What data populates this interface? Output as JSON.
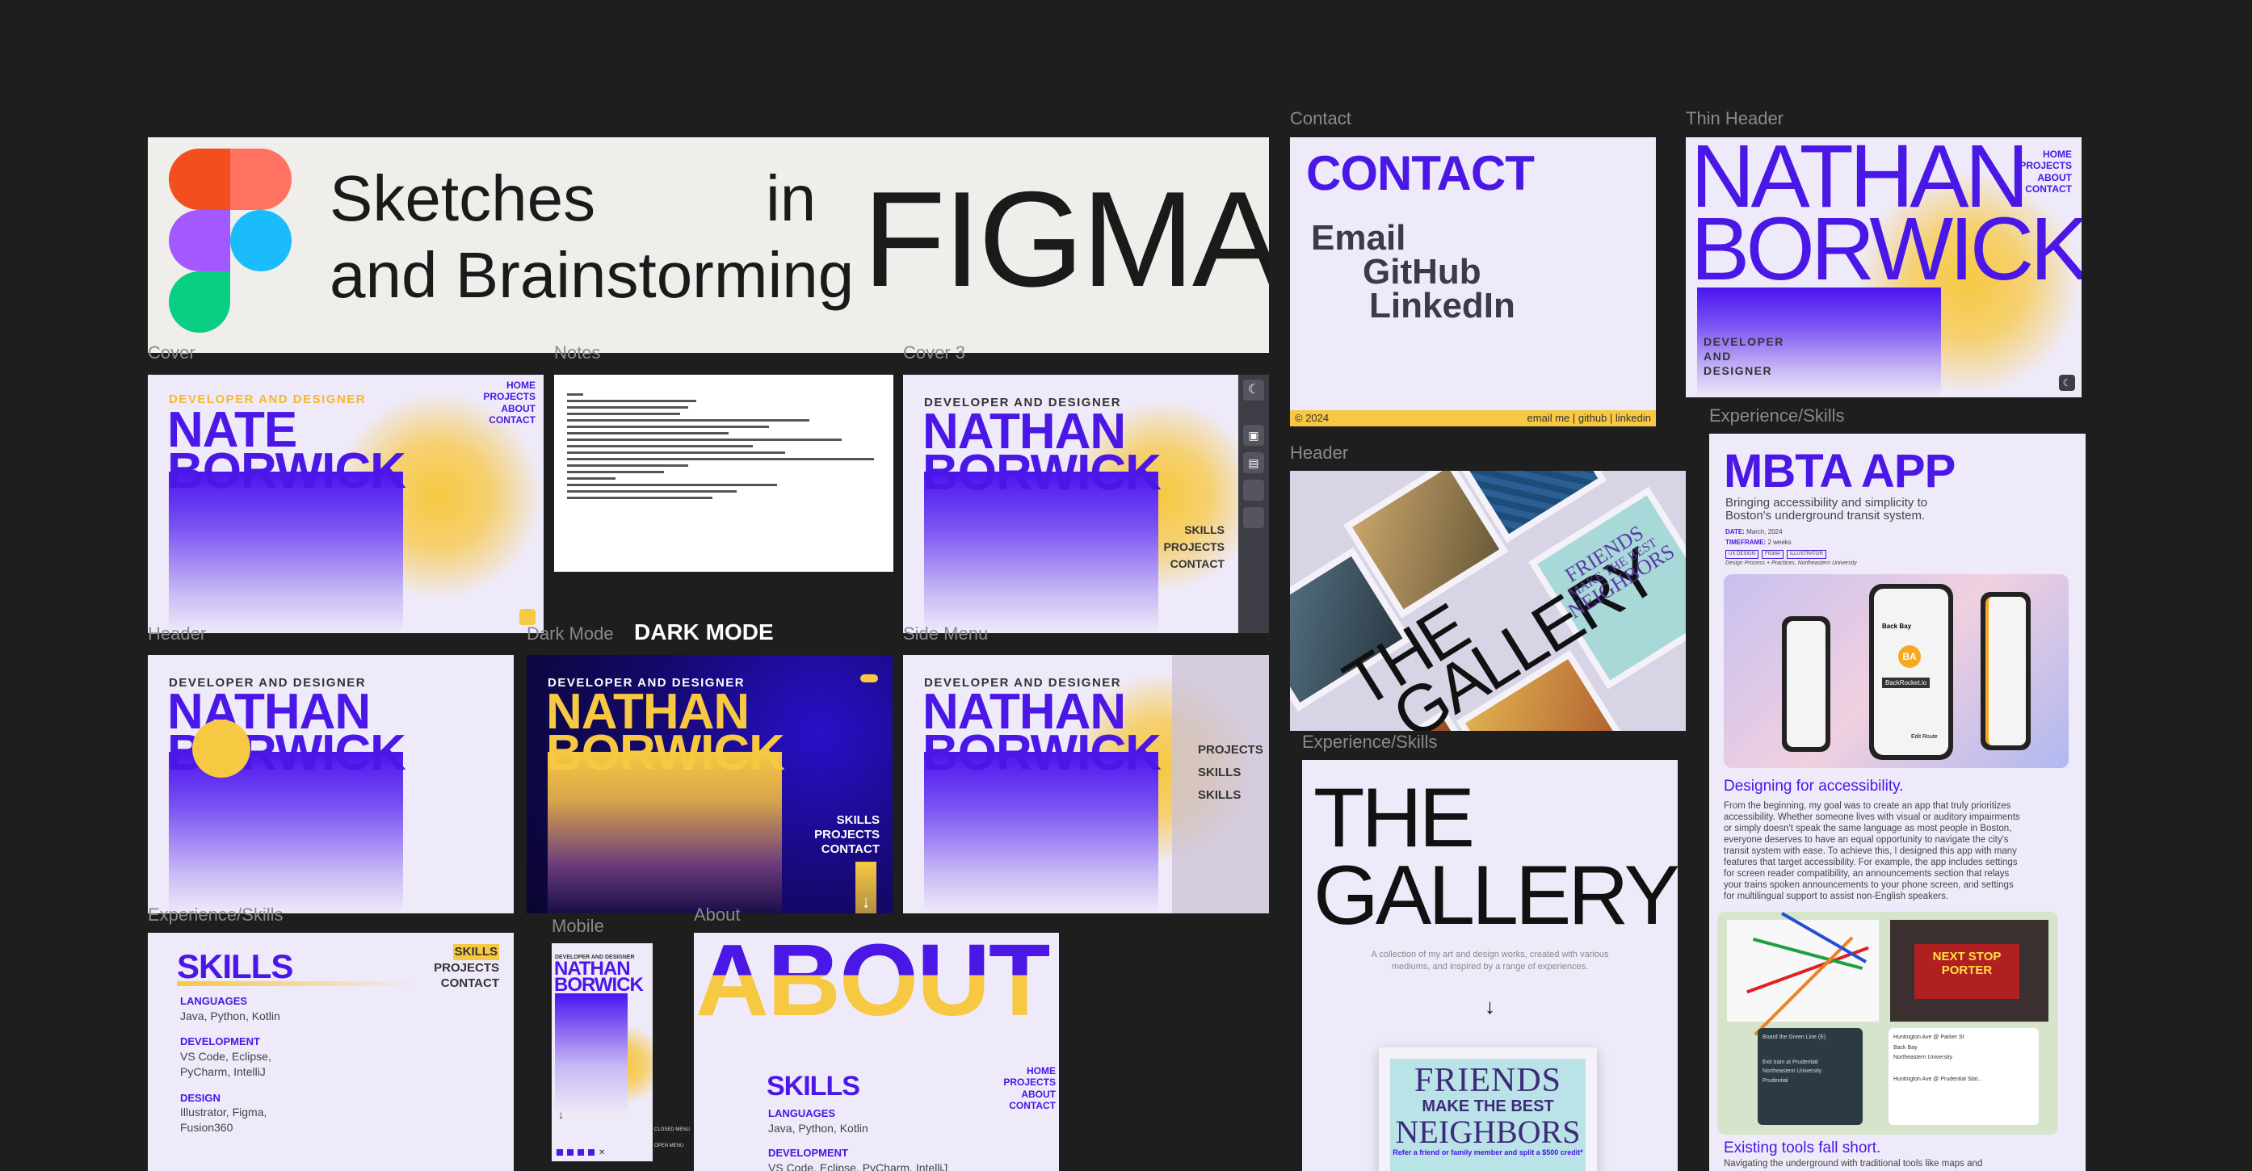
{
  "title_banner": {
    "line1": "Sketches",
    "word_in": "in",
    "line2": "and Brainstorming",
    "figma": "FIGMA"
  },
  "labels": {
    "cover": "Cover",
    "notes": "Notes",
    "cover3": "Cover 3",
    "header": "Header",
    "dark_mode": "Dark Mode",
    "side_menu": "Side Menu",
    "experience_skills": "Experience/Skills",
    "mobile": "Mobile",
    "about": "About",
    "contact": "Contact",
    "thin_header": "Thin Header",
    "header2": "Header",
    "experience_skills2": "Experience/Skills",
    "experience_skills3": "Experience/Skills"
  },
  "dark_mode_heading": "DARK MODE",
  "common": {
    "dev_designer": "DEVELOPER AND DESIGNER",
    "nathan": "NATHAN",
    "borwick": "BORWICK",
    "nate": "NATE",
    "nav": [
      "HOME",
      "PROJECTS",
      "ABOUT",
      "CONTACT"
    ],
    "nav3": [
      "SKILLS",
      "PROJECTS",
      "CONTACT"
    ],
    "side": [
      "PROJECTS",
      "SKILLS",
      "SKILLS"
    ],
    "arrow": "↓"
  },
  "skills": {
    "title": "SKILLS",
    "nav": [
      "SKILLS",
      "PROJECTS",
      "CONTACT"
    ],
    "groups": [
      {
        "h": "LANGUAGES",
        "t": [
          "Java, Python, Kotlin"
        ]
      },
      {
        "h": "DEVELOPMENT",
        "t": [
          "VS Code, Eclipse,",
          "PyCharm, IntelliJ"
        ]
      },
      {
        "h": "DESIGN",
        "t": [
          "Illustrator, Figma,",
          "Fusion360"
        ]
      }
    ]
  },
  "mobile": {
    "head": "DEVELOPER AND DESIGNER",
    "close": "CLOSED MENU",
    "open": "OPEN MENU"
  },
  "about": {
    "title": "ABOUT",
    "skills": "SKILLS",
    "g1h": "LANGUAGES",
    "g1t": "Java, Python, Kotlin",
    "g2h": "DEVELOPMENT",
    "g2t": "VS Code, Eclipse, PyCharm, IntelliJ"
  },
  "contact": {
    "title": "CONTACT",
    "email": "Email",
    "github": "GitHub",
    "linkedin": "LinkedIn",
    "footer_left": "© 2024",
    "footer_right": "email me | github | linkedin"
  },
  "thin": {
    "line1": "NATHAN",
    "line2": "BORWICK",
    "sub": [
      "DEVELOPER",
      "AND",
      "DESIGNER"
    ]
  },
  "gallery_header": {
    "title1": "THE",
    "title2": "GALLERY",
    "book1": "FRIENDS",
    "book2": "MAKE THE BEST",
    "book3": "NEIGHBORS"
  },
  "gallery_page": {
    "title1": "THE",
    "title2": "GALLERY",
    "desc1": "A collection of my art and design works, created with various",
    "desc2": "mediums, and inspired by a range of experiences.",
    "poster1": "FRIENDS",
    "poster2": "MAKE THE BEST",
    "poster3": "NEIGHBORS",
    "poster4": "Refer a friend or family member and split a $500 credit*"
  },
  "mbta": {
    "title": "MBTA APP",
    "sub1": "Bringing accessibility and simplicity to",
    "sub2": "Boston's underground transit system.",
    "date_label": "DATE:",
    "date": "March, 2024",
    "tf_label": "TIMEFRAME:",
    "tf": "2 weeks",
    "tags": [
      "UX DESIGN",
      "FIGMA",
      "ILLUSTRATOR"
    ],
    "course": "Design Process + Practices, Northeastern University",
    "h1": "Designing for accessibility.",
    "p1": [
      "From the beginning, my goal was to create an app that truly prioritizes",
      "accessibility. Whether someone lives with visual or auditory impairments",
      "or simply doesn't speak the same language as most people in Boston,",
      "everyone deserves to have an equal opportunity to navigate the city's",
      "transit system with ease. To achieve this,  I designed this app with many",
      "features that target accessibility. For example, the app includes settings",
      "for screen reader compatibility, an announcements section that relays",
      "your trains spoken announcements  to your phone screen, and settings",
      "for multilingual support to assist non-English speakers."
    ],
    "h2": "Existing tools fall short.",
    "p2": "Navigating the underground with traditional tools like maps and",
    "phone_text": [
      "BA",
      "Back Bay",
      "BackRocket.io",
      "Edit Route"
    ],
    "screen_text": [
      "NEXT STOP",
      "PORTER"
    ],
    "transit": [
      "Board the Green Line (E)",
      "Exit train at Prudential",
      "Huntington Ave @ Parker St",
      "Back Bay",
      "Northeastern University",
      "Prudential",
      "Huntington Ave @ Prudential Stat..."
    ]
  },
  "colors": {
    "accent": "#4a17e6",
    "sun": "#f7c842",
    "bg": "#1e1e1e",
    "card": "#efeaf9"
  }
}
